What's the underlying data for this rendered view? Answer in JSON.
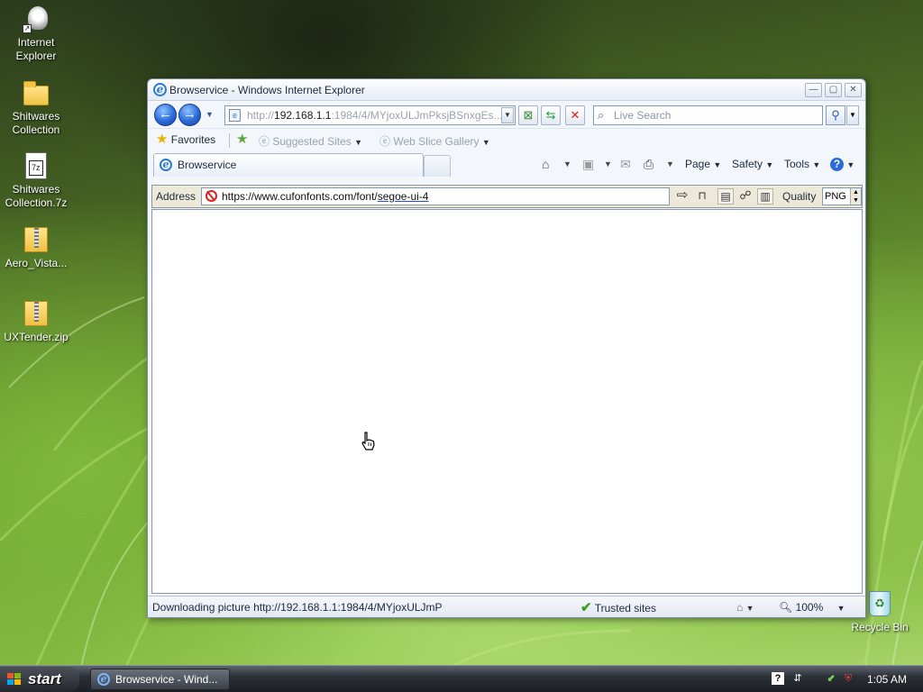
{
  "desktop": {
    "icons": [
      {
        "label1": "Internet",
        "label2": "Explorer"
      },
      {
        "label1": "Shitwares",
        "label2": "Collection"
      },
      {
        "label1": "Shitwares",
        "label2": "Collection.7z"
      },
      {
        "label1": "Aero_Vista...",
        "label2": ""
      },
      {
        "label1": "UXTender.zip",
        "label2": ""
      }
    ],
    "recycle_bin": "Recycle Bin"
  },
  "window": {
    "title": "Browservice - Windows Internet Explorer",
    "address": {
      "prefix": "http://",
      "host": "192.168.1.1",
      "rest": ":1984/4/MYjoxULJmPksjBSnxgEs..."
    },
    "search_placeholder": "Live Search",
    "favorites": {
      "favorites_label": "Favorites",
      "suggested_sites": "Suggested Sites",
      "web_slice_gallery": "Web Slice Gallery"
    },
    "tab_label": "Browservice",
    "command_bar": {
      "page": "Page",
      "safety": "Safety",
      "tools": "Tools"
    },
    "inner_bar": {
      "address_label": "Address",
      "url_before": "https://www.cufonfonts.com/font/",
      "url_underlined": "segoe-ui-4",
      "quality_label": "Quality",
      "quality_value": "PNG"
    },
    "status": {
      "text": "Downloading picture http://192.168.1.1:1984/4/MYjoxULJmP",
      "zone": "Trusted sites",
      "zoom": "100%"
    }
  },
  "taskbar": {
    "start_label": "start",
    "task_label": "Browservice - Wind...",
    "clock": "1:05 AM"
  },
  "colors": {
    "accent": "#2b6bd8",
    "trusted_check": "#3aa02a"
  }
}
